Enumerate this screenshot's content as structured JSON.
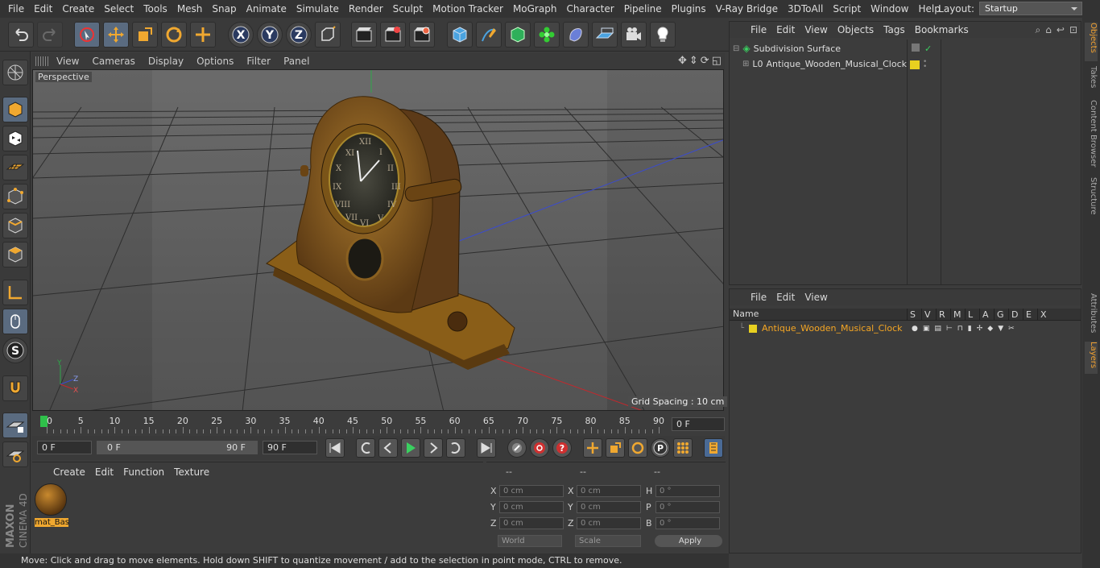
{
  "menu": [
    "File",
    "Edit",
    "Create",
    "Select",
    "Tools",
    "Mesh",
    "Snap",
    "Animate",
    "Simulate",
    "Render",
    "Sculpt",
    "Motion Tracker",
    "MoGraph",
    "Character",
    "Pipeline",
    "Plugins",
    "V-Ray Bridge",
    "3DToAll",
    "Script",
    "Window",
    "Help"
  ],
  "layout": {
    "label": "Layout:",
    "value": "Startup"
  },
  "viewport": {
    "menu": [
      "View",
      "Cameras",
      "Display",
      "Options",
      "Filter",
      "Panel"
    ],
    "label": "Perspective",
    "grid_spacing": "Grid Spacing : 10 cm",
    "axis": {
      "y": "Y",
      "z": "Z",
      "x": "X"
    }
  },
  "timeline": {
    "ticks": [
      "0",
      "5",
      "10",
      "15",
      "20",
      "25",
      "30",
      "35",
      "40",
      "45",
      "50",
      "55",
      "60",
      "65",
      "70",
      "75",
      "80",
      "85",
      "90"
    ],
    "current_frame": "0 F"
  },
  "transport": {
    "start": "0 F",
    "range_start": "0 F",
    "range_end": "90 F",
    "end": "90 F"
  },
  "materials": {
    "menu": [
      "Create",
      "Edit",
      "Function",
      "Texture"
    ],
    "items": [
      {
        "name": "mat_Bas"
      }
    ]
  },
  "coords": {
    "headers": [
      "--",
      "--",
      "--"
    ],
    "rows": [
      {
        "a": "X",
        "av": "0 cm",
        "b": "X",
        "bv": "0 cm",
        "c": "H",
        "cv": "0 °"
      },
      {
        "a": "Y",
        "av": "0 cm",
        "b": "Y",
        "bv": "0 cm",
        "c": "P",
        "cv": "0 °"
      },
      {
        "a": "Z",
        "av": "0 cm",
        "b": "Z",
        "bv": "0 cm",
        "c": "B",
        "cv": "0 °"
      }
    ],
    "mode": "World",
    "scale": "Scale",
    "apply": "Apply"
  },
  "objects": {
    "menu": [
      "File",
      "Edit",
      "View",
      "Objects",
      "Tags",
      "Bookmarks"
    ],
    "tree": [
      {
        "name": "Subdivision Surface"
      },
      {
        "name": "Antique_Wooden_Musical_Clock"
      }
    ]
  },
  "layers": {
    "menu": [
      "File",
      "Edit",
      "View"
    ],
    "name_header": "Name",
    "flag_headers": [
      "S",
      "V",
      "R",
      "M",
      "L",
      "A",
      "G",
      "D",
      "E",
      "X"
    ],
    "rows": [
      {
        "name": "Antique_Wooden_Musical_Clock"
      }
    ]
  },
  "right_tabs": [
    "Objects",
    "Takes",
    "Content Browser",
    "Structure",
    "Attributes",
    "Layers"
  ],
  "status": "Move: Click and drag to move elements. Hold down SHIFT to quantize movement / add to the selection in point mode, CTRL to remove.",
  "brand": {
    "maxon": "MAXON",
    "c4d": "CINEMA 4D"
  },
  "colors": {
    "accent": "#f5a623",
    "layer": "#e8d020",
    "x_axis": "#c8262b",
    "z_axis": "#3a4bd0",
    "y_axis": "#2ea84a"
  }
}
